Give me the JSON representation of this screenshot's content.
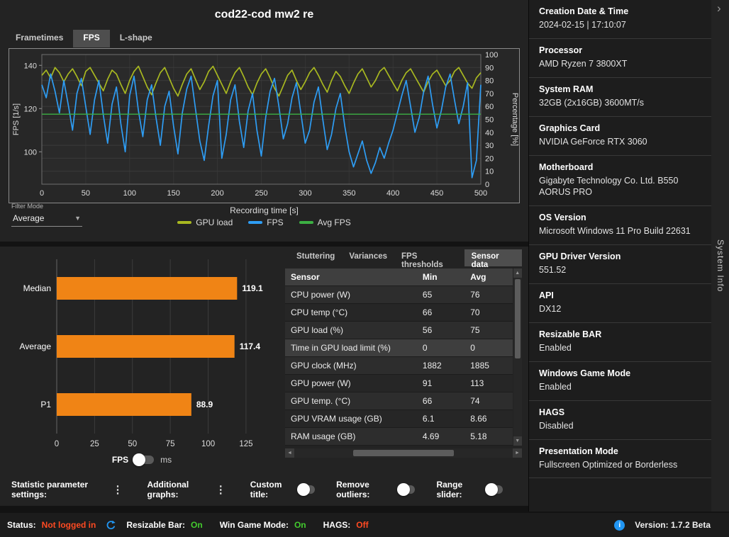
{
  "header": {
    "title": "cod22-cod mw2 re"
  },
  "main_tabs": [
    {
      "label": "Frametimes",
      "active": false
    },
    {
      "label": "FPS",
      "active": true
    },
    {
      "label": "L-shape",
      "active": false
    }
  ],
  "filter": {
    "label": "Filter Mode",
    "value": "Average"
  },
  "fps_ms_toggle": {
    "left": "FPS",
    "right": "ms"
  },
  "sensor_tabs": [
    {
      "label": "Stuttering",
      "active": false
    },
    {
      "label": "Variances",
      "active": false
    },
    {
      "label": "FPS thresholds",
      "active": false
    },
    {
      "label": "Sensor data",
      "active": true
    }
  ],
  "sensor_table": {
    "headers": [
      "Sensor",
      "Min",
      "Avg"
    ],
    "rows": [
      [
        "CPU power (W)",
        "65",
        "76"
      ],
      [
        "CPU temp (°C)",
        "66",
        "70"
      ],
      [
        "GPU load (%)",
        "56",
        "75"
      ],
      [
        "Time in GPU load limit (%)",
        "0",
        "0"
      ],
      [
        "GPU clock (MHz)",
        "1882",
        "1885"
      ],
      [
        "GPU power (W)",
        "91",
        "113"
      ],
      [
        "GPU temp. (°C)",
        "66",
        "74"
      ],
      [
        "GPU VRAM usage (GB)",
        "6.1",
        "8.66"
      ],
      [
        "RAM usage (GB)",
        "4.69",
        "5.18"
      ]
    ],
    "highlighted_row": 3
  },
  "controls": {
    "stat_settings": "Statistic parameter settings:",
    "additional_graphs": "Additional graphs:",
    "custom_title": "Custom title:",
    "remove_outliers": "Remove outliers:",
    "range_slider": "Range slider:"
  },
  "sidebar": {
    "title": "System Info",
    "items": [
      {
        "label": "Creation Date & Time",
        "value": "2024-02-15  |  17:10:07"
      },
      {
        "label": "Processor",
        "value": "AMD Ryzen 7 3800XT"
      },
      {
        "label": "System RAM",
        "value": "32GB (2x16GB) 3600MT/s"
      },
      {
        "label": "Graphics Card",
        "value": "NVIDIA GeForce RTX 3060"
      },
      {
        "label": "Motherboard",
        "value": "Gigabyte Technology Co. Ltd. B550 AORUS PRO"
      },
      {
        "label": "OS Version",
        "value": "Microsoft Windows 11 Pro Build 22631"
      },
      {
        "label": "GPU Driver Version",
        "value": "551.52"
      },
      {
        "label": "API",
        "value": "DX12"
      },
      {
        "label": "Resizable BAR",
        "value": "Enabled"
      },
      {
        "label": "Windows Game Mode",
        "value": "Enabled"
      },
      {
        "label": "HAGS",
        "value": "Disabled"
      },
      {
        "label": "Presentation Mode",
        "value": "Fullscreen Optimized or Borderless"
      }
    ]
  },
  "statusbar": {
    "status_label": "Status:",
    "status_value": "Not logged in",
    "resizable_label": "Resizable Bar:",
    "resizable_value": "On",
    "gamemode_label": "Win Game Mode:",
    "gamemode_value": "On",
    "hags_label": "HAGS:",
    "hags_value": "Off",
    "version": "Version: 1.7.2 Beta"
  },
  "colors": {
    "accent_blue": "#2196f3",
    "ok_green": "#43cc2e",
    "err_red": "#ff4a22",
    "bar_orange": "#f08415",
    "fps_blue": "#2e9df4",
    "gpu_load_olive": "#a8b820",
    "avg_green": "#3cb043"
  },
  "chart_data": [
    {
      "type": "line",
      "xlabel": "Recording time [s]",
      "ylabel_left": "FPS [1/s]",
      "ylabel_right": "Percentage [%]",
      "xlim": [
        0,
        500
      ],
      "x_start": 0,
      "x_step": 5,
      "x_ticks": [
        0,
        50,
        100,
        150,
        200,
        250,
        300,
        350,
        400,
        450,
        500
      ],
      "left_ylim": [
        85,
        145
      ],
      "left_ticks": [
        100,
        120,
        140
      ],
      "right_ylim": [
        0,
        100
      ],
      "right_ticks": [
        0,
        10,
        20,
        30,
        40,
        50,
        60,
        70,
        80,
        90,
        100
      ],
      "grid": true,
      "legend_position": "bottom",
      "series": [
        {
          "name": "GPU load",
          "axis": "right",
          "color": "#a8b820",
          "values": [
            84,
            88,
            82,
            90,
            86,
            79,
            85,
            89,
            83,
            76,
            87,
            90,
            84,
            78,
            72,
            81,
            88,
            85,
            77,
            70,
            80,
            87,
            91,
            83,
            75,
            69,
            78,
            86,
            90,
            82,
            74,
            68,
            77,
            85,
            89,
            81,
            73,
            79,
            87,
            91,
            84,
            77,
            70,
            79,
            86,
            90,
            83,
            75,
            69,
            78,
            85,
            89,
            82,
            74,
            68,
            76,
            84,
            88,
            80,
            73,
            79,
            86,
            90,
            84,
            77,
            71,
            80,
            87,
            83,
            76,
            70,
            78,
            85,
            89,
            82,
            75,
            80,
            87,
            90,
            84,
            78,
            72,
            80,
            86,
            89,
            83,
            77,
            71,
            79,
            85,
            88,
            82,
            76,
            80,
            87,
            90,
            84,
            78,
            74,
            82,
            86
          ]
        },
        {
          "name": "FPS",
          "axis": "left",
          "color": "#2e9df4",
          "values": [
            131,
            125,
            136,
            128,
            118,
            133,
            122,
            110,
            127,
            134,
            121,
            108,
            124,
            133,
            117,
            104,
            122,
            130,
            113,
            100,
            126,
            135,
            119,
            107,
            124,
            131,
            116,
            103,
            121,
            128,
            112,
            99,
            118,
            129,
            135,
            120,
            105,
            96,
            112,
            126,
            133,
            97,
            108,
            124,
            131,
            114,
            102,
            119,
            127,
            110,
            98,
            116,
            128,
            134,
            121,
            106,
            113,
            125,
            132,
            118,
            104,
            110,
            123,
            130,
            115,
            101,
            108,
            120,
            127,
            112,
            100,
            93,
            99,
            105,
            96,
            90,
            95,
            102,
            97,
            104,
            110,
            118,
            126,
            133,
            121,
            109,
            116,
            128,
            135,
            122,
            111,
            119,
            130,
            136,
            124,
            113,
            121,
            132,
            88,
            96,
            131
          ]
        },
        {
          "name": "Avg FPS",
          "axis": "left",
          "color": "#3cb043",
          "const_value": 117.4
        }
      ]
    },
    {
      "type": "bar",
      "orientation": "horizontal",
      "categories": [
        "Median",
        "Average",
        "P1"
      ],
      "values": [
        119.1,
        117.4,
        88.9
      ],
      "labels": [
        "119.1",
        "117.4",
        "88.9"
      ],
      "xlabel": "FPS",
      "xlim": [
        0,
        133
      ],
      "x_ticks": [
        0,
        25,
        50,
        75,
        100,
        125
      ],
      "bar_color": "#f08415"
    }
  ]
}
